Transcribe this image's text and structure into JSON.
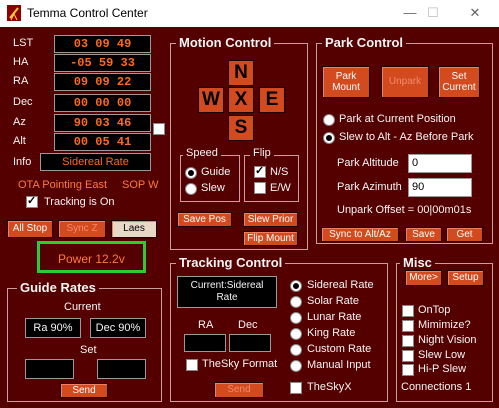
{
  "window": {
    "title": "Temma Control Center",
    "minimize": "—",
    "maximize": "☐",
    "close": "✕"
  },
  "coords": {
    "lst_label": "LST",
    "lst": "03 09 49",
    "ha_label": "HA",
    "ha": "-05 59 33",
    "ra_label": "RA",
    "ra": "09 09 22",
    "dec_label": "Dec",
    "dec": "00 00 00",
    "az_label": "Az",
    "az": "90 03 46",
    "alt_label": "Alt",
    "alt": "00 05 41",
    "info_label": "Info",
    "info": "Sidereal Rate"
  },
  "status": {
    "ota": "OTA Pointing East",
    "sop": "SOP W",
    "tracking_label": "Tracking is On",
    "tracking_checked": true
  },
  "buttons": {
    "all_stop": "All Stop",
    "sync_z": "Sync Z",
    "laes": "Laes"
  },
  "power": {
    "label": "Power 12.2v",
    "highlight_color": "#2ecc2e"
  },
  "motion": {
    "title": "Motion Control",
    "north": "N",
    "south": "S",
    "east": "E",
    "west": "W",
    "stop": "X",
    "speed_title": "Speed",
    "guide": "Guide",
    "slew": "Slew",
    "speed_selected": "Guide",
    "flip_title": "Flip",
    "ns": "N/S",
    "ew": "E/W",
    "ns_checked": true,
    "ew_checked": false,
    "save_pos": "Save Pos",
    "slew_prior": "Slew Prior",
    "flip_mount": "Flip Mount"
  },
  "park": {
    "title": "Park Control",
    "park_mount": [
      "Park",
      "Mount"
    ],
    "unpark": "Unpark",
    "set_current": [
      "Set",
      "Current"
    ],
    "opt_current": "Park at Current Position",
    "opt_slew": "Slew to Alt - Az Before Park",
    "selected": "slew",
    "altitude_label": "Park Altitude",
    "altitude": "0",
    "azimuth_label": "Park Azimuth",
    "azimuth": "90",
    "unpark_offset": "Unpark Offset = 00|00m01s",
    "sync_alt_az": "Sync to Alt/Az",
    "save": "Save",
    "get": "Get"
  },
  "guide_rates": {
    "title": "Guide Rates",
    "current_label": "Current",
    "ra_rate": "Ra 90%",
    "dec_rate": "Dec 90%",
    "set_label": "Set",
    "ra_set": "",
    "dec_set": "",
    "send": "Send"
  },
  "tracking": {
    "title": "Tracking Control",
    "current": [
      "Current:Sidereal",
      "Rate"
    ],
    "ra_label": "RA",
    "dec_label": "Dec",
    "ra_value": "",
    "dec_value": "",
    "thesky_format": "TheSky Format",
    "thesky_format_checked": false,
    "send": "Send",
    "rates": [
      "Sidereal Rate",
      "Solar Rate",
      "Lunar Rate",
      "King Rate",
      "Custom Rate",
      "Manual Input"
    ],
    "selected_rate": "Sidereal Rate",
    "theskyx": "TheSkyX",
    "theskyx_checked": false
  },
  "misc": {
    "title": "Misc",
    "more": "More>",
    "setup": "Setup",
    "options": [
      "OnTop",
      "Mimimize?",
      "Night Vision",
      "Slew Low",
      "Hi-P Slew"
    ],
    "connections": "Connections 1"
  },
  "colors": {
    "background": "#550000",
    "value_text": "#ff6a1a",
    "button": "#d44a1f"
  }
}
